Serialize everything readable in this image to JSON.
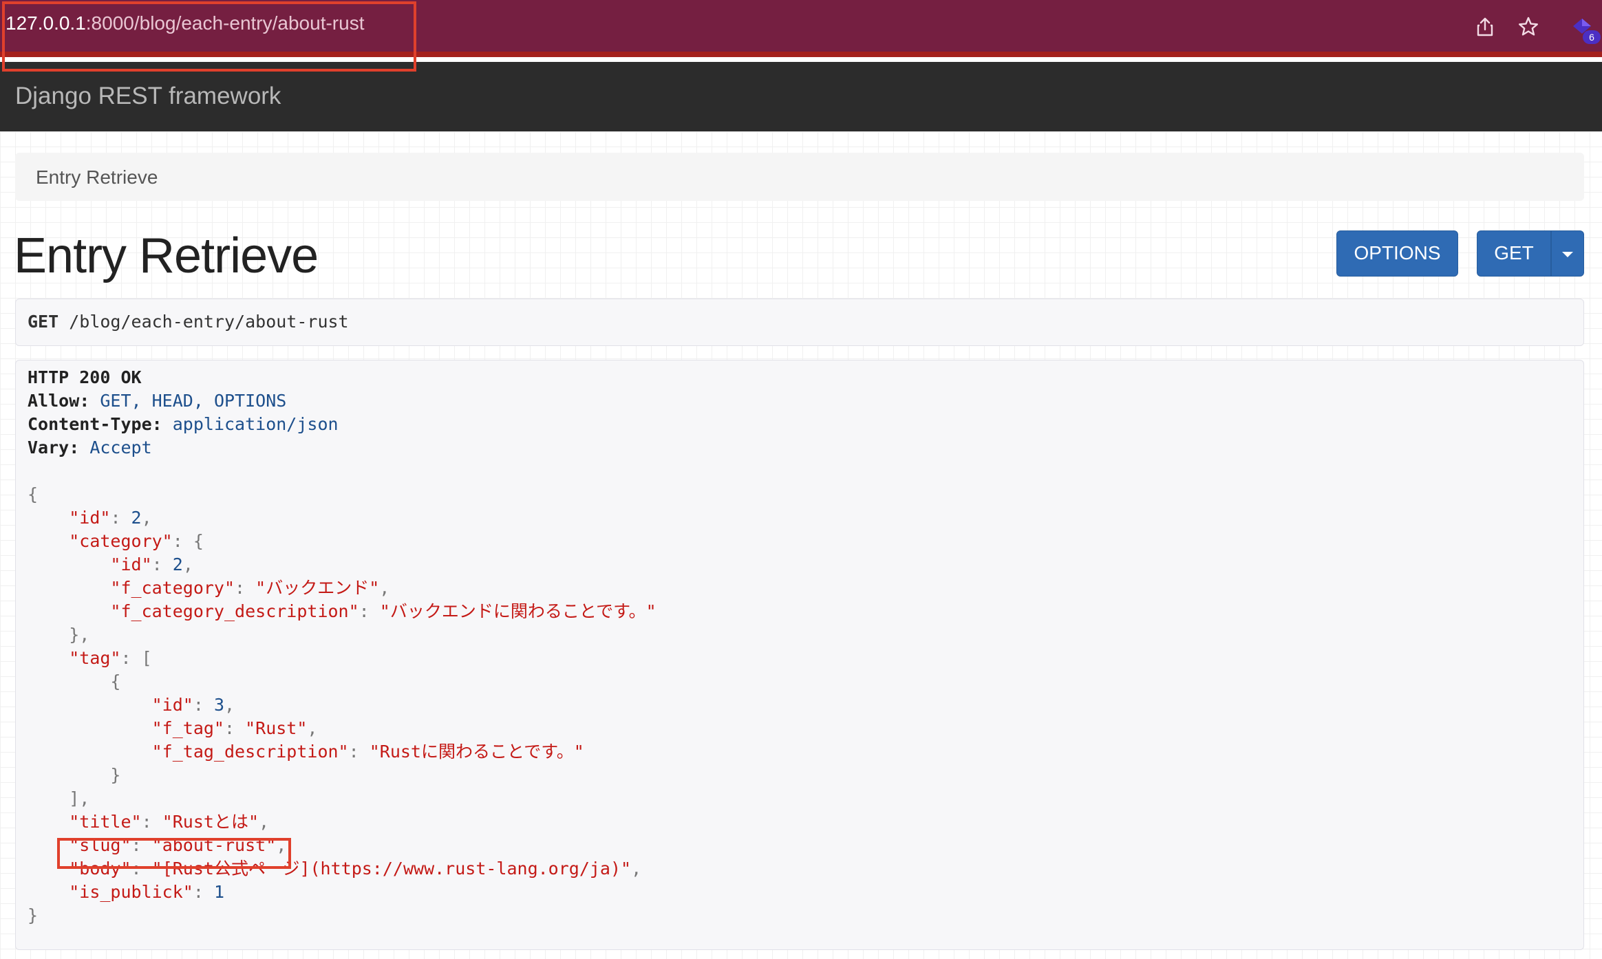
{
  "browser": {
    "url_host": "127.0.0.1",
    "url_path": ":8000/blog/each-entry/about-rust",
    "extension_badge": "6",
    "icons": [
      "share-icon",
      "star-icon",
      "extension-icon"
    ]
  },
  "navbar": {
    "brand": "Django REST framework"
  },
  "breadcrumb": {
    "label": "Entry Retrieve"
  },
  "page": {
    "title": "Entry Retrieve"
  },
  "buttons": {
    "options": "OPTIONS",
    "get": "GET"
  },
  "request": {
    "method": "GET",
    "path": "/blog/each-entry/about-rust"
  },
  "response": {
    "status": "HTTP 200 OK",
    "headers": [
      {
        "key": "Allow:",
        "value": "GET, HEAD, OPTIONS"
      },
      {
        "key": "Content-Type:",
        "value": "application/json"
      },
      {
        "key": "Vary:",
        "value": "Accept"
      }
    ],
    "body": {
      "open": "{",
      "id_key": "\"id\"",
      "id_val": "2",
      "category_key": "\"category\"",
      "category_open": "{",
      "cat_id_key": "\"id\"",
      "cat_id_val": "2",
      "f_category_key": "\"f_category\"",
      "f_category_val": "\"バックエンド\"",
      "f_category_desc_key": "\"f_category_description\"",
      "f_category_desc_val": "\"バックエンドに関わることです。\"",
      "category_close": "},",
      "tag_key": "\"tag\"",
      "tag_open": "[",
      "tag_obj_open": "{",
      "tag_id_key": "\"id\"",
      "tag_id_val": "3",
      "f_tag_key": "\"f_tag\"",
      "f_tag_val": "\"Rust\"",
      "f_tag_desc_key": "\"f_tag_description\"",
      "f_tag_desc_val": "\"Rustに関わることです。\"",
      "tag_obj_close": "}",
      "tag_close": "],",
      "title_key": "\"title\"",
      "title_val": "\"Rustとは\"",
      "slug_key": "\"slug\"",
      "slug_val": "\"about-rust\"",
      "body_key": "\"body\"",
      "body_val": "\"[Rust公式ページ](https://www.rust-lang.org/ja)\"",
      "is_publick_key": "\"is_publick\"",
      "is_publick_val": "1",
      "close": "}"
    }
  }
}
